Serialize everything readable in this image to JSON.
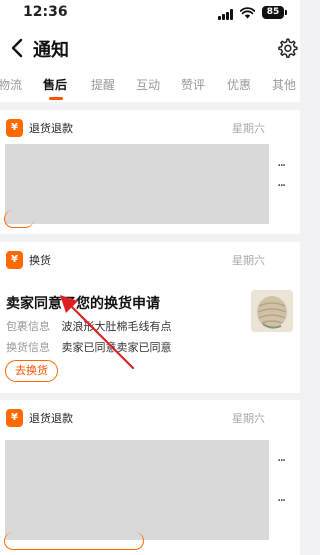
{
  "status_bar": {
    "time": "12:36",
    "battery": "85"
  },
  "header": {
    "title": "通知"
  },
  "tabs": [
    {
      "label": "物流"
    },
    {
      "label": "售后",
      "active": true
    },
    {
      "label": "提醒"
    },
    {
      "label": "互动"
    },
    {
      "label": "赞评"
    },
    {
      "label": "优惠"
    },
    {
      "label": "其他"
    }
  ],
  "cards": [
    {
      "type": "退货退款",
      "day": "星期六"
    },
    {
      "type": "换货",
      "day": "星期六",
      "title": "卖家同意了您的换货申请",
      "rows": [
        {
          "label": "包裹信息",
          "value": "波浪形大肚棉毛线有点"
        },
        {
          "label": "换货信息",
          "value": "卖家已同意卖家已同意"
        }
      ],
      "action": "去换货"
    },
    {
      "type": "退货退款",
      "day": "星期六"
    }
  ],
  "colors": {
    "accent": "#ff5000",
    "brand": "#ff6a00",
    "arrow": "#e02020"
  }
}
